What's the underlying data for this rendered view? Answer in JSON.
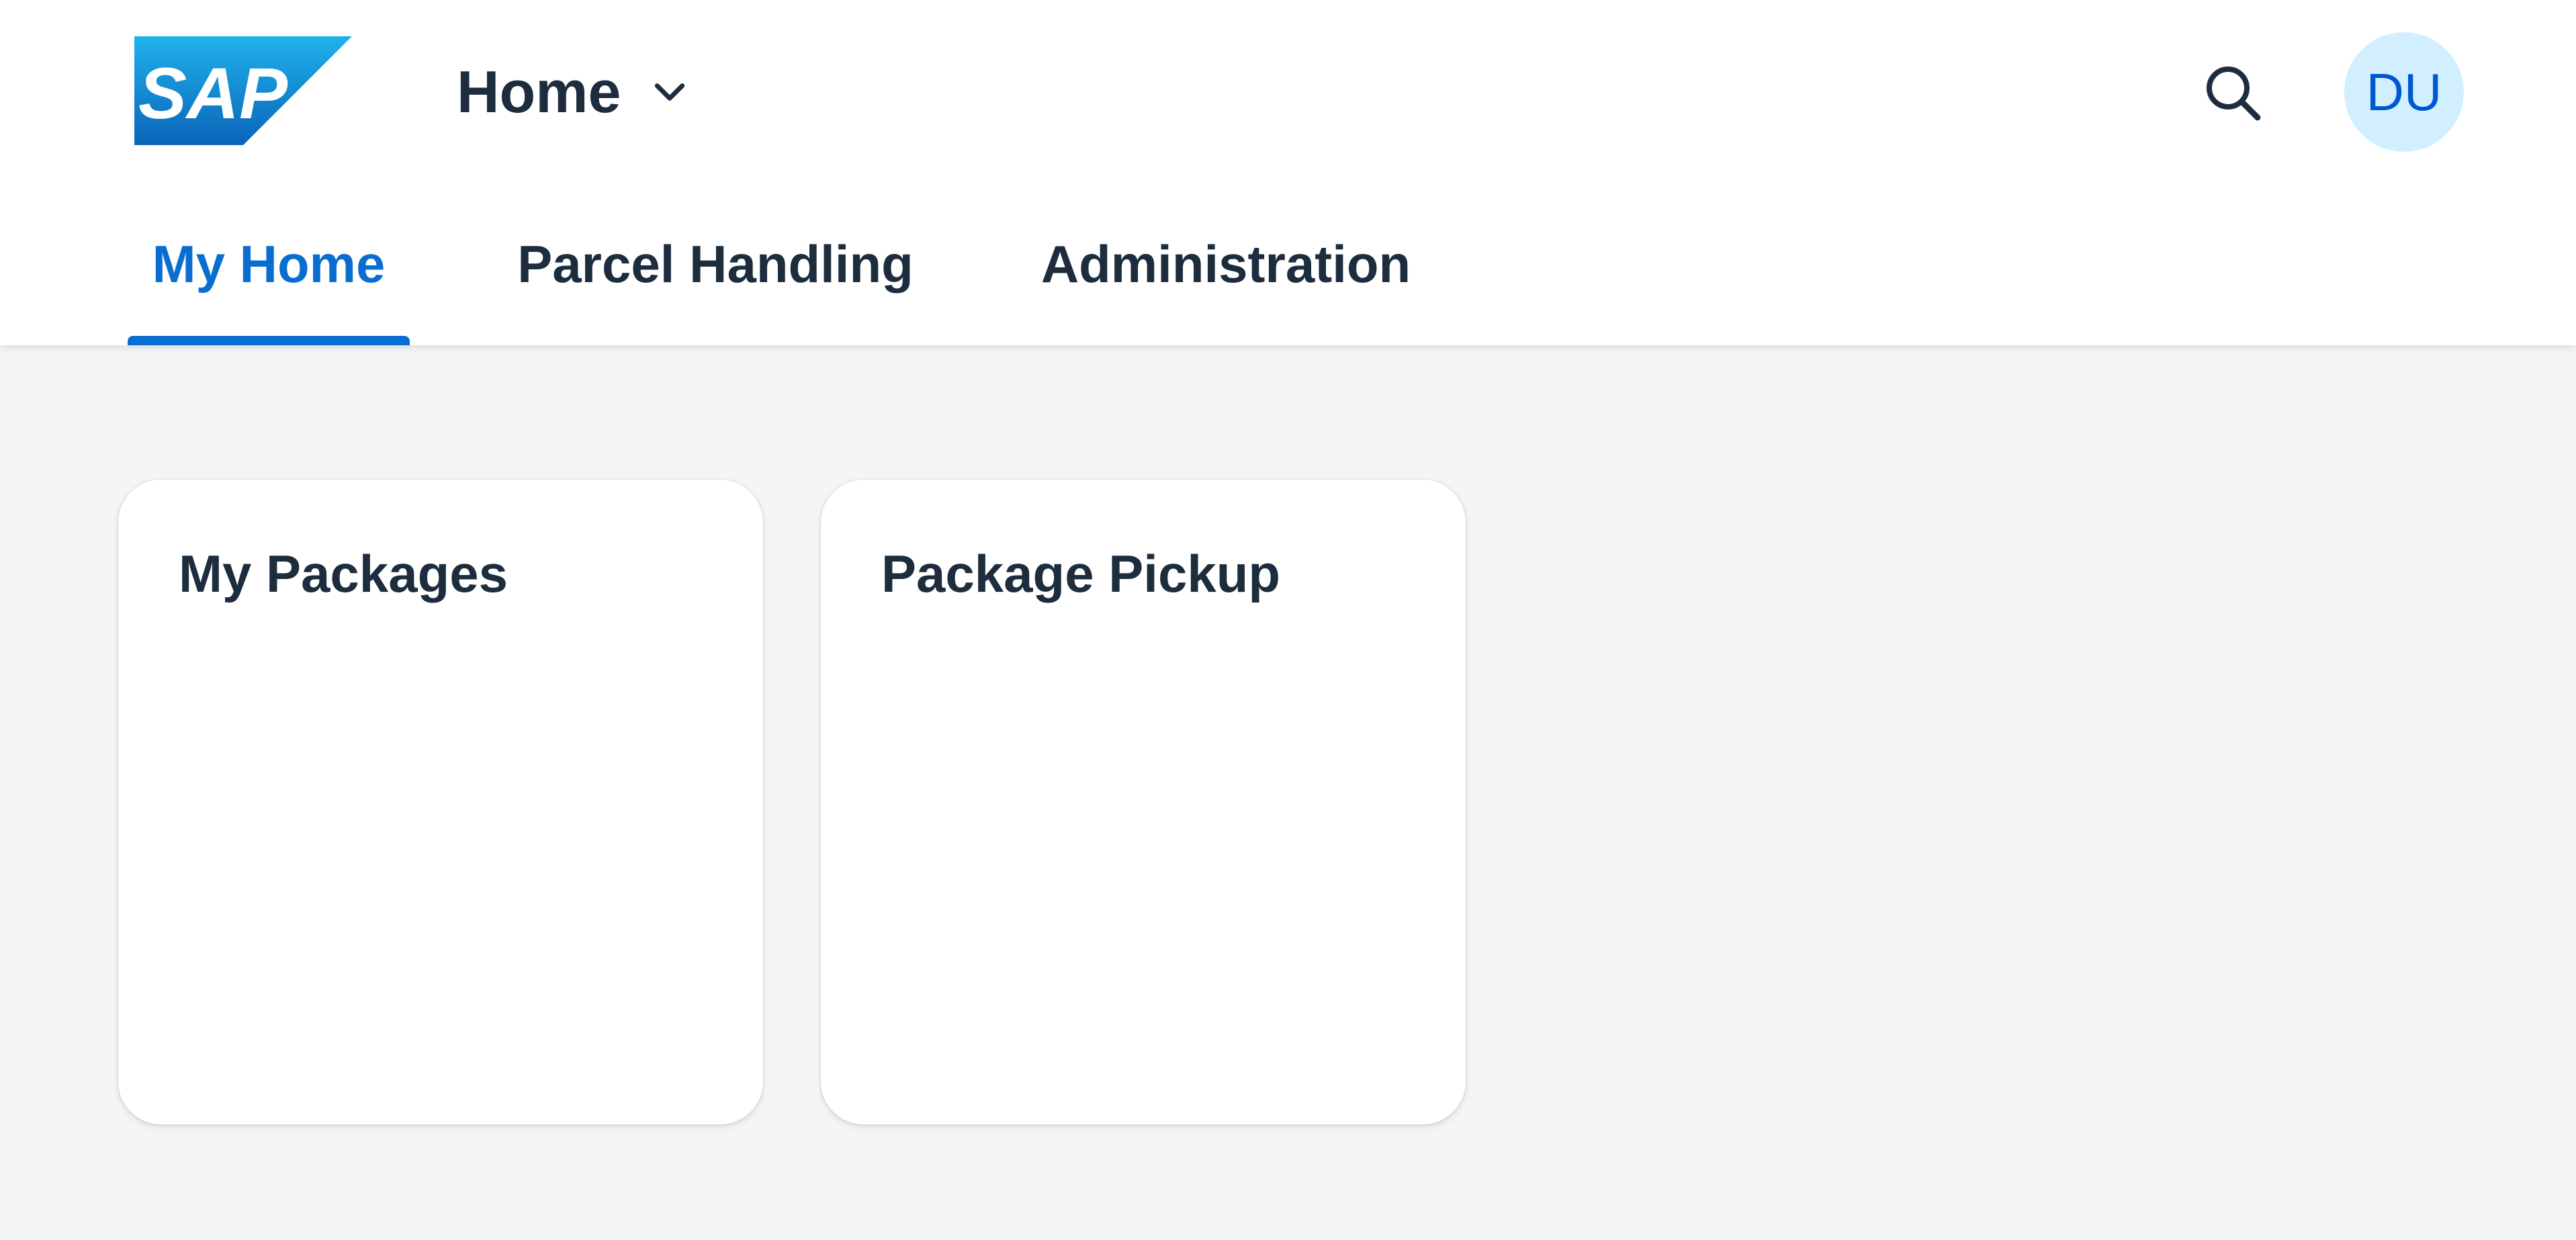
{
  "header": {
    "logo_text": "SAP",
    "home_menu": {
      "label": "Home",
      "icon": "chevron-down-icon"
    },
    "search": {
      "icon": "search-icon"
    },
    "user": {
      "initials": "DU"
    }
  },
  "tabs": [
    {
      "label": "My Home",
      "active": true
    },
    {
      "label": "Parcel Handling",
      "active": false
    },
    {
      "label": "Administration",
      "active": false
    }
  ],
  "tiles": [
    {
      "title": "My Packages"
    },
    {
      "title": "Package Pickup"
    }
  ],
  "colors": {
    "accent": "#0a6ed1",
    "text": "#1d2d3e",
    "background": "#f4f5f7",
    "avatar_bg": "#d1efff",
    "avatar_text": "#0057d2"
  }
}
